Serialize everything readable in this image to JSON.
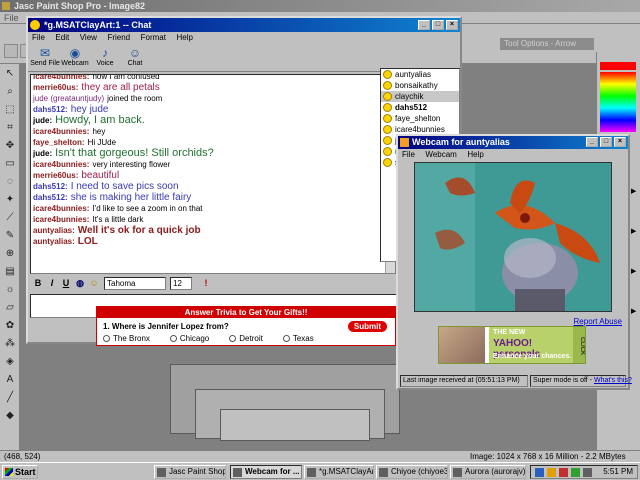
{
  "psp": {
    "title": "Jasc Paint Shop Pro - Image82",
    "menu": [
      "File"
    ],
    "tool_options": "Tool Options - Arrow",
    "status_coords": "(468, 524)",
    "status_image": "Image:  1024 x 768 x 16 Million - 2.2 MBytes"
  },
  "chat": {
    "title": "*g.MSATClayArt:1 -- Chat",
    "menu": [
      "File",
      "Edit",
      "View",
      "Friend",
      "Format",
      "Help"
    ],
    "toolbar": [
      "Send File",
      "Webcam",
      "Voice",
      "Chat"
    ],
    "messages": [
      {
        "nick": "icare4bunnies:",
        "text": "now I am confused",
        "color": "#8b1a1a",
        "size": "8px"
      },
      {
        "nick": "merrie60us:",
        "text": "they are all petals",
        "color": "#8b1a1a",
        "size": "10px",
        "text_color": "#a02050"
      },
      {
        "nick": "jude (greatauntjudy)",
        "text": "joined the room",
        "color": "#7a2a7a",
        "size": "8px",
        "plain": true
      },
      {
        "nick": "dahs512:",
        "text": "hey jude",
        "color": "#3a3ab0",
        "size": "10px",
        "text_color": "#3a3ab0"
      },
      {
        "nick": "jude:",
        "text": "Howdy, I am back.",
        "color": "#000000",
        "size": "11px",
        "text_color": "#207030"
      },
      {
        "nick": "icare4bunnies:",
        "text": "hey",
        "color": "#8b1a1a",
        "size": "8px"
      },
      {
        "nick": "faye_shelton:",
        "text": "Hi JUde",
        "color": "#8b1a1a",
        "size": "8px"
      },
      {
        "nick": "jude:",
        "text": "Isn't that gorgeous! Still orchids?",
        "color": "#000000",
        "size": "11px",
        "text_color": "#207030"
      },
      {
        "nick": "icare4bunnies:",
        "text": "very interesting flower",
        "color": "#8b1a1a",
        "size": "8px"
      },
      {
        "nick": "merrie60us:",
        "text": "beautiful",
        "color": "#8b1a1a",
        "size": "10px",
        "text_color": "#a02050"
      },
      {
        "nick": "dahs512:",
        "text": "I need to save pics soon",
        "color": "#3a3ab0",
        "size": "10px",
        "text_color": "#3a3ab0"
      },
      {
        "nick": "dahs512:",
        "text": "she is making her little fairy",
        "color": "#3a3ab0",
        "size": "10px",
        "text_color": "#3a3ab0"
      },
      {
        "nick": "icare4bunnies:",
        "text": "I'd like to see a zoom in on that",
        "color": "#8b1a1a",
        "size": "8px"
      },
      {
        "nick": "icare4bunnies:",
        "text": "It's a little dark",
        "color": "#8b1a1a",
        "size": "8px"
      },
      {
        "nick": "auntyalias:",
        "text": "Well it's ok for a quick job",
        "color": "#8b1a1a",
        "size": "10px",
        "text_color": "#8b1a1a",
        "bold": true
      },
      {
        "nick": "auntyalias:",
        "text": "LOL",
        "color": "#8b1a1a",
        "size": "10px",
        "text_color": "#8b1a1a",
        "bold": true
      }
    ],
    "users": [
      "auntyalias",
      "bonsaikathy",
      "claychik",
      "dahs512",
      "faye_shelton",
      "icare4bunnies",
      "j...",
      "m...",
      "s..."
    ],
    "selected_user": 2,
    "format": {
      "font": "Tahoma",
      "size": "12"
    }
  },
  "trivia": {
    "header": "Answer Trivia to Get Your Gifts!!",
    "question": "1. Where is Jennifer Lopez from?",
    "submit": "Submit",
    "options": [
      "The Bronx",
      "Chicago",
      "Detroit",
      "Texas"
    ]
  },
  "webcam": {
    "title": "Webcam for auntyalias",
    "menu": [
      "File",
      "Webcam",
      "Help"
    ],
    "report": "Report Abuse",
    "ad": {
      "line1": "THE NEW",
      "line2": "YAHOO! personals",
      "line3": "Enhance your chances.",
      "click": "CLICK"
    },
    "status_left": "Last image received at (05:51:13 PM)",
    "status_right": "Super mode is off - ",
    "status_link": "What's this?"
  },
  "taskbar": {
    "start": "Start",
    "tasks": [
      "Jasc Paint Shop ...",
      "Webcam for ...",
      "*g.MSATClayArt...",
      "Chiyoe (chiyoe3...",
      "Aurora (aurorajv)..."
    ],
    "active_task": 1,
    "clock": "5:51 PM"
  }
}
